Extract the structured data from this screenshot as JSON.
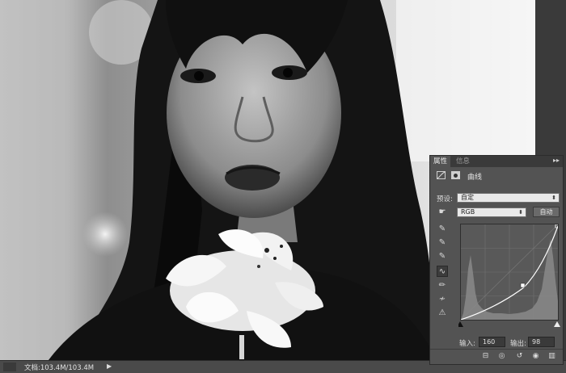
{
  "statusbar": {
    "doc_info": "文档:103.4M/103.4M",
    "arrow": "▶"
  },
  "panel": {
    "tabs": [
      {
        "label": "属性"
      },
      {
        "label": "信息"
      }
    ],
    "collapse_icon": "double-chevron-right",
    "title": "曲线",
    "preset_label": "预设:",
    "preset_value": "自定",
    "channel_value": "RGB",
    "auto_button": "自动",
    "input_label": "输入:",
    "input_value": "160",
    "output_label": "输出:",
    "output_value": "98",
    "tools": [
      "sample-shadow-icon",
      "sample-midtone-icon",
      "sample-highlight-icon",
      "curve-point-icon",
      "pencil-icon",
      "smooth-icon",
      "clipping-warning-icon"
    ],
    "footer_icons": [
      "clip-to-layer-icon",
      "view-previous-icon",
      "reset-icon",
      "visibility-icon",
      "delete-icon"
    ]
  },
  "colors": {
    "panel_bg": "#535353",
    "tab_bg": "#3a3a3a",
    "curve": "#ffffff"
  }
}
